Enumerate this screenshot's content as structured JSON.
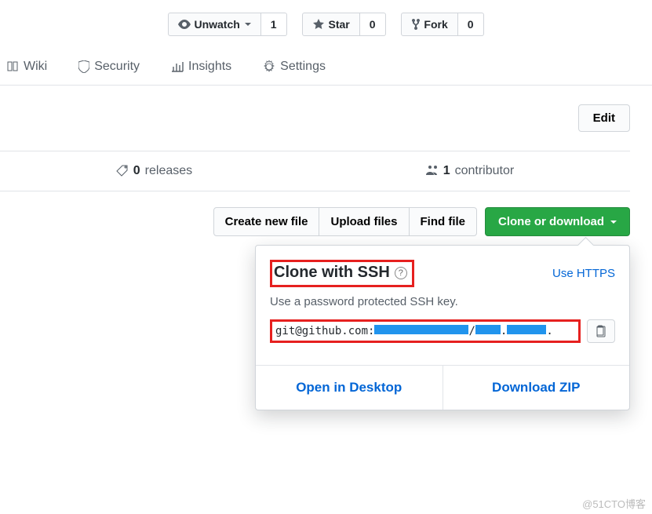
{
  "watchbar": {
    "unwatch": "Unwatch",
    "unwatch_count": "1",
    "star": "Star",
    "star_count": "0",
    "fork": "Fork",
    "fork_count": "0"
  },
  "tabs": {
    "wiki": "Wiki",
    "security": "Security",
    "insights": "Insights",
    "settings": "Settings"
  },
  "edit_label": "Edit",
  "stats": {
    "releases_count": "0",
    "releases_label": "releases",
    "contributor_count": "1",
    "contributor_label": "contributor"
  },
  "actions": {
    "create_file": "Create new file",
    "upload_files": "Upload files",
    "find_file": "Find file",
    "clone": "Clone or download"
  },
  "clone": {
    "title": "Clone with SSH",
    "use_https": "Use HTTPS",
    "desc": "Use a password protected SSH key.",
    "url_prefix": "git@github.com:",
    "open_desktop": "Open in Desktop",
    "download_zip": "Download ZIP"
  },
  "watermark": "@51CTO博客"
}
